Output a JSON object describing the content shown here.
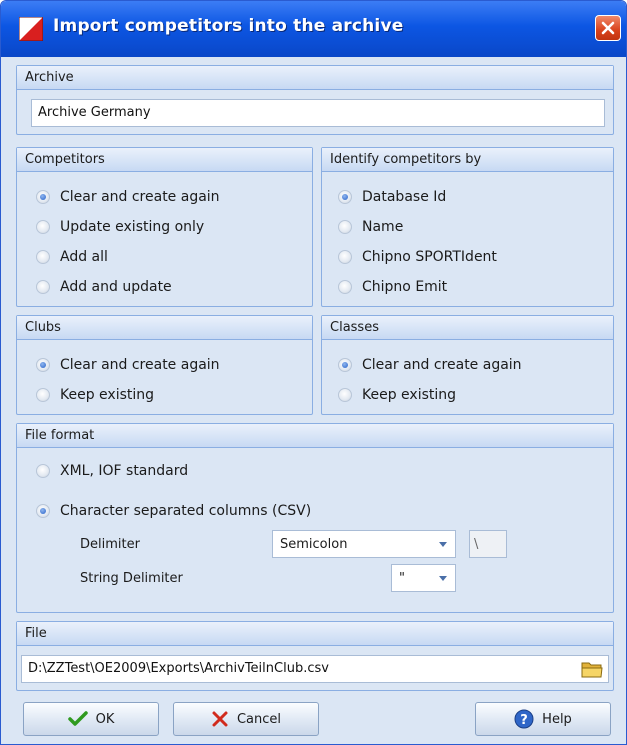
{
  "window": {
    "title": "Import competitors into the archive"
  },
  "archive": {
    "header": "Archive",
    "value": "Archive Germany"
  },
  "competitors": {
    "header": "Competitors",
    "options": [
      {
        "label": "Clear and create again",
        "checked": true
      },
      {
        "label": "Update existing only",
        "checked": false
      },
      {
        "label": "Add all",
        "checked": false
      },
      {
        "label": "Add and update",
        "checked": false
      }
    ]
  },
  "identify": {
    "header": "Identify competitors by",
    "options": [
      {
        "label": "Database Id",
        "checked": true
      },
      {
        "label": "Name",
        "checked": false
      },
      {
        "label": "Chipno SPORTIdent",
        "checked": false
      },
      {
        "label": "Chipno Emit",
        "checked": false
      }
    ]
  },
  "clubs": {
    "header": "Clubs",
    "options": [
      {
        "label": "Clear and create again",
        "checked": true
      },
      {
        "label": "Keep existing",
        "checked": false
      }
    ]
  },
  "classes": {
    "header": "Classes",
    "options": [
      {
        "label": "Clear and create again",
        "checked": true
      },
      {
        "label": "Keep existing",
        "checked": false
      }
    ]
  },
  "file_format": {
    "header": "File format",
    "options": [
      {
        "label": "XML, IOF standard",
        "checked": false
      },
      {
        "label": "Character separated columns (CSV)",
        "checked": true
      }
    ],
    "delimiter_label": "Delimiter",
    "delimiter_value": "Semicolon",
    "delimiter_custom": "\\",
    "string_delimiter_label": "String Delimiter",
    "string_delimiter_value": "\""
  },
  "file": {
    "header": "File",
    "path": "D:\\ZZTest\\OE2009\\Exports\\ArchivTeilnClub.csv"
  },
  "buttons": {
    "ok": "OK",
    "cancel": "Cancel",
    "help": "Help"
  },
  "icons": {
    "app": "app-flag-icon",
    "close": "close-icon",
    "folder": "folder-icon",
    "ok": "checkmark-icon",
    "cancel": "x-icon",
    "help": "help-icon",
    "dropdown": "chevron-down-icon"
  },
  "colors": {
    "titlebar": "#0c56e3",
    "panel": "#dbe6f4",
    "border": "#8aaee2",
    "close": "#d9421b"
  }
}
